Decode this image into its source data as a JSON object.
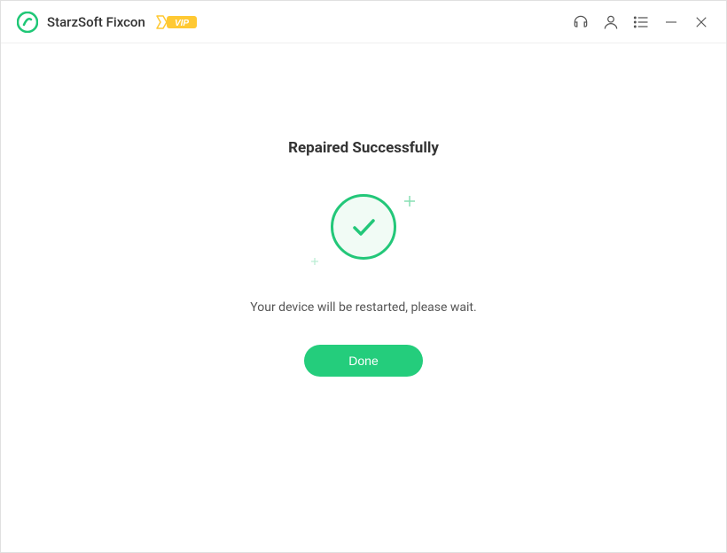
{
  "titlebar": {
    "app_title": "StarzSoft Fixcon",
    "vip_label": "VIP"
  },
  "content": {
    "heading": "Repaired Successfully",
    "message": "Your device will be restarted, please wait.",
    "done_label": "Done"
  },
  "colors": {
    "accent": "#24cd7c",
    "vip_badge": "#ffc933"
  }
}
